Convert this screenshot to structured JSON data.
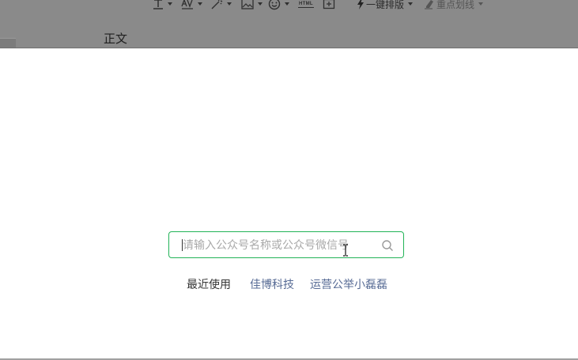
{
  "editor": {
    "toolbar": {
      "items": [
        {
          "icon": "letter-spacing-icon",
          "has_dropdown": true
        },
        {
          "icon": "av-kerning-icon",
          "has_dropdown": true
        },
        {
          "icon": "magic-wand-icon",
          "has_dropdown": true
        },
        {
          "icon": "image-icon",
          "has_dropdown": true
        },
        {
          "icon": "emoji-icon",
          "has_dropdown": true
        },
        {
          "icon": "html-icon",
          "label": "HTML"
        },
        {
          "icon": "insert-widget-icon"
        }
      ],
      "one_click_layout_label": "一键排版",
      "highlight_label": "重点划线"
    },
    "body_style_label": "正文"
  },
  "search": {
    "placeholder": "请输入公众号名称或公众号微信号",
    "value": "",
    "border_color": "#22b357"
  },
  "recent": {
    "label": "最近使用",
    "items": [
      "佳博科技",
      "运营公举小磊磊"
    ],
    "link_color": "#576b95"
  }
}
